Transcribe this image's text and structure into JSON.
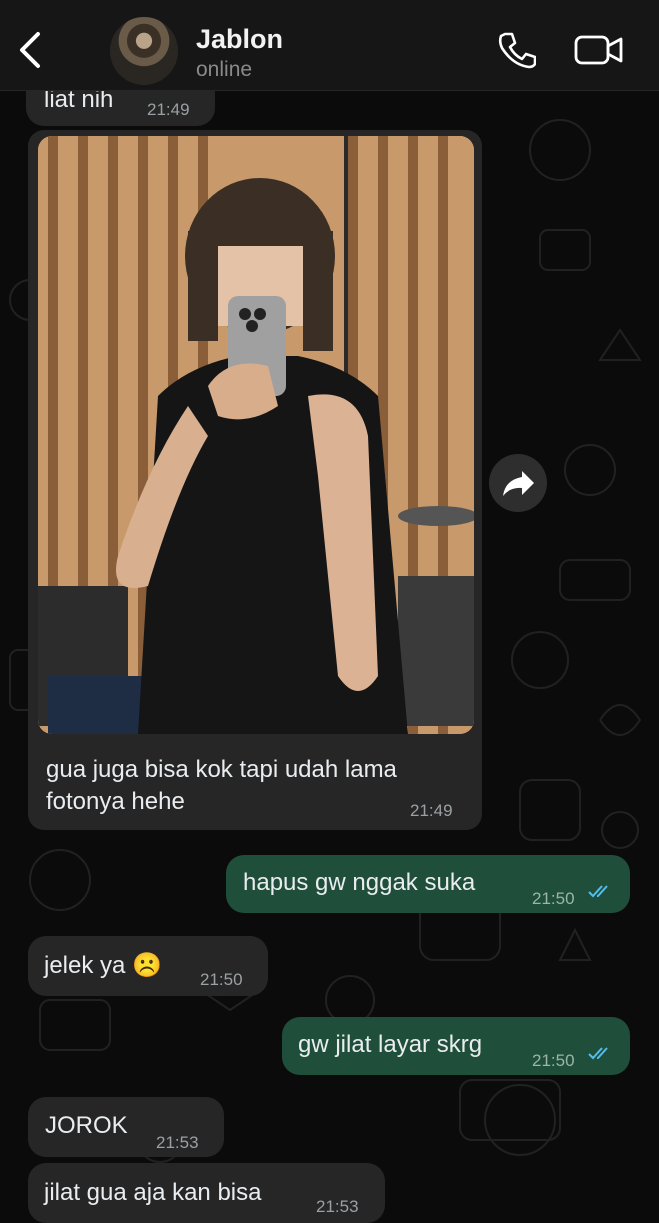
{
  "header": {
    "contact_name": "Jablon",
    "status": "online",
    "icons": [
      "back-icon",
      "phone-icon",
      "video-camera-icon"
    ]
  },
  "messages": [
    {
      "direction": "incoming",
      "text": "liat nih",
      "time": "21:49"
    },
    {
      "direction": "incoming",
      "type": "photo",
      "caption": "gua juga bisa kok tapi udah lama fotonya hehe",
      "time": "21:49"
    },
    {
      "direction": "outgoing",
      "text": "hapus gw nggak suka",
      "time": "21:50",
      "read": true
    },
    {
      "direction": "incoming",
      "text": "jelek ya ☹️",
      "time": "21:50"
    },
    {
      "direction": "outgoing",
      "text": "gw jilat layar skrg",
      "time": "21:50",
      "read": true
    },
    {
      "direction": "incoming",
      "text": "JOROK",
      "time": "21:53"
    },
    {
      "direction": "incoming",
      "text": "jilat gua aja kan bisa",
      "time": "21:53"
    }
  ],
  "colors": {
    "incoming_bubble": "#262626",
    "outgoing_bubble": "#1f4e3a",
    "read_ticks": "#53bdeb",
    "background": "#0b0b0b"
  }
}
